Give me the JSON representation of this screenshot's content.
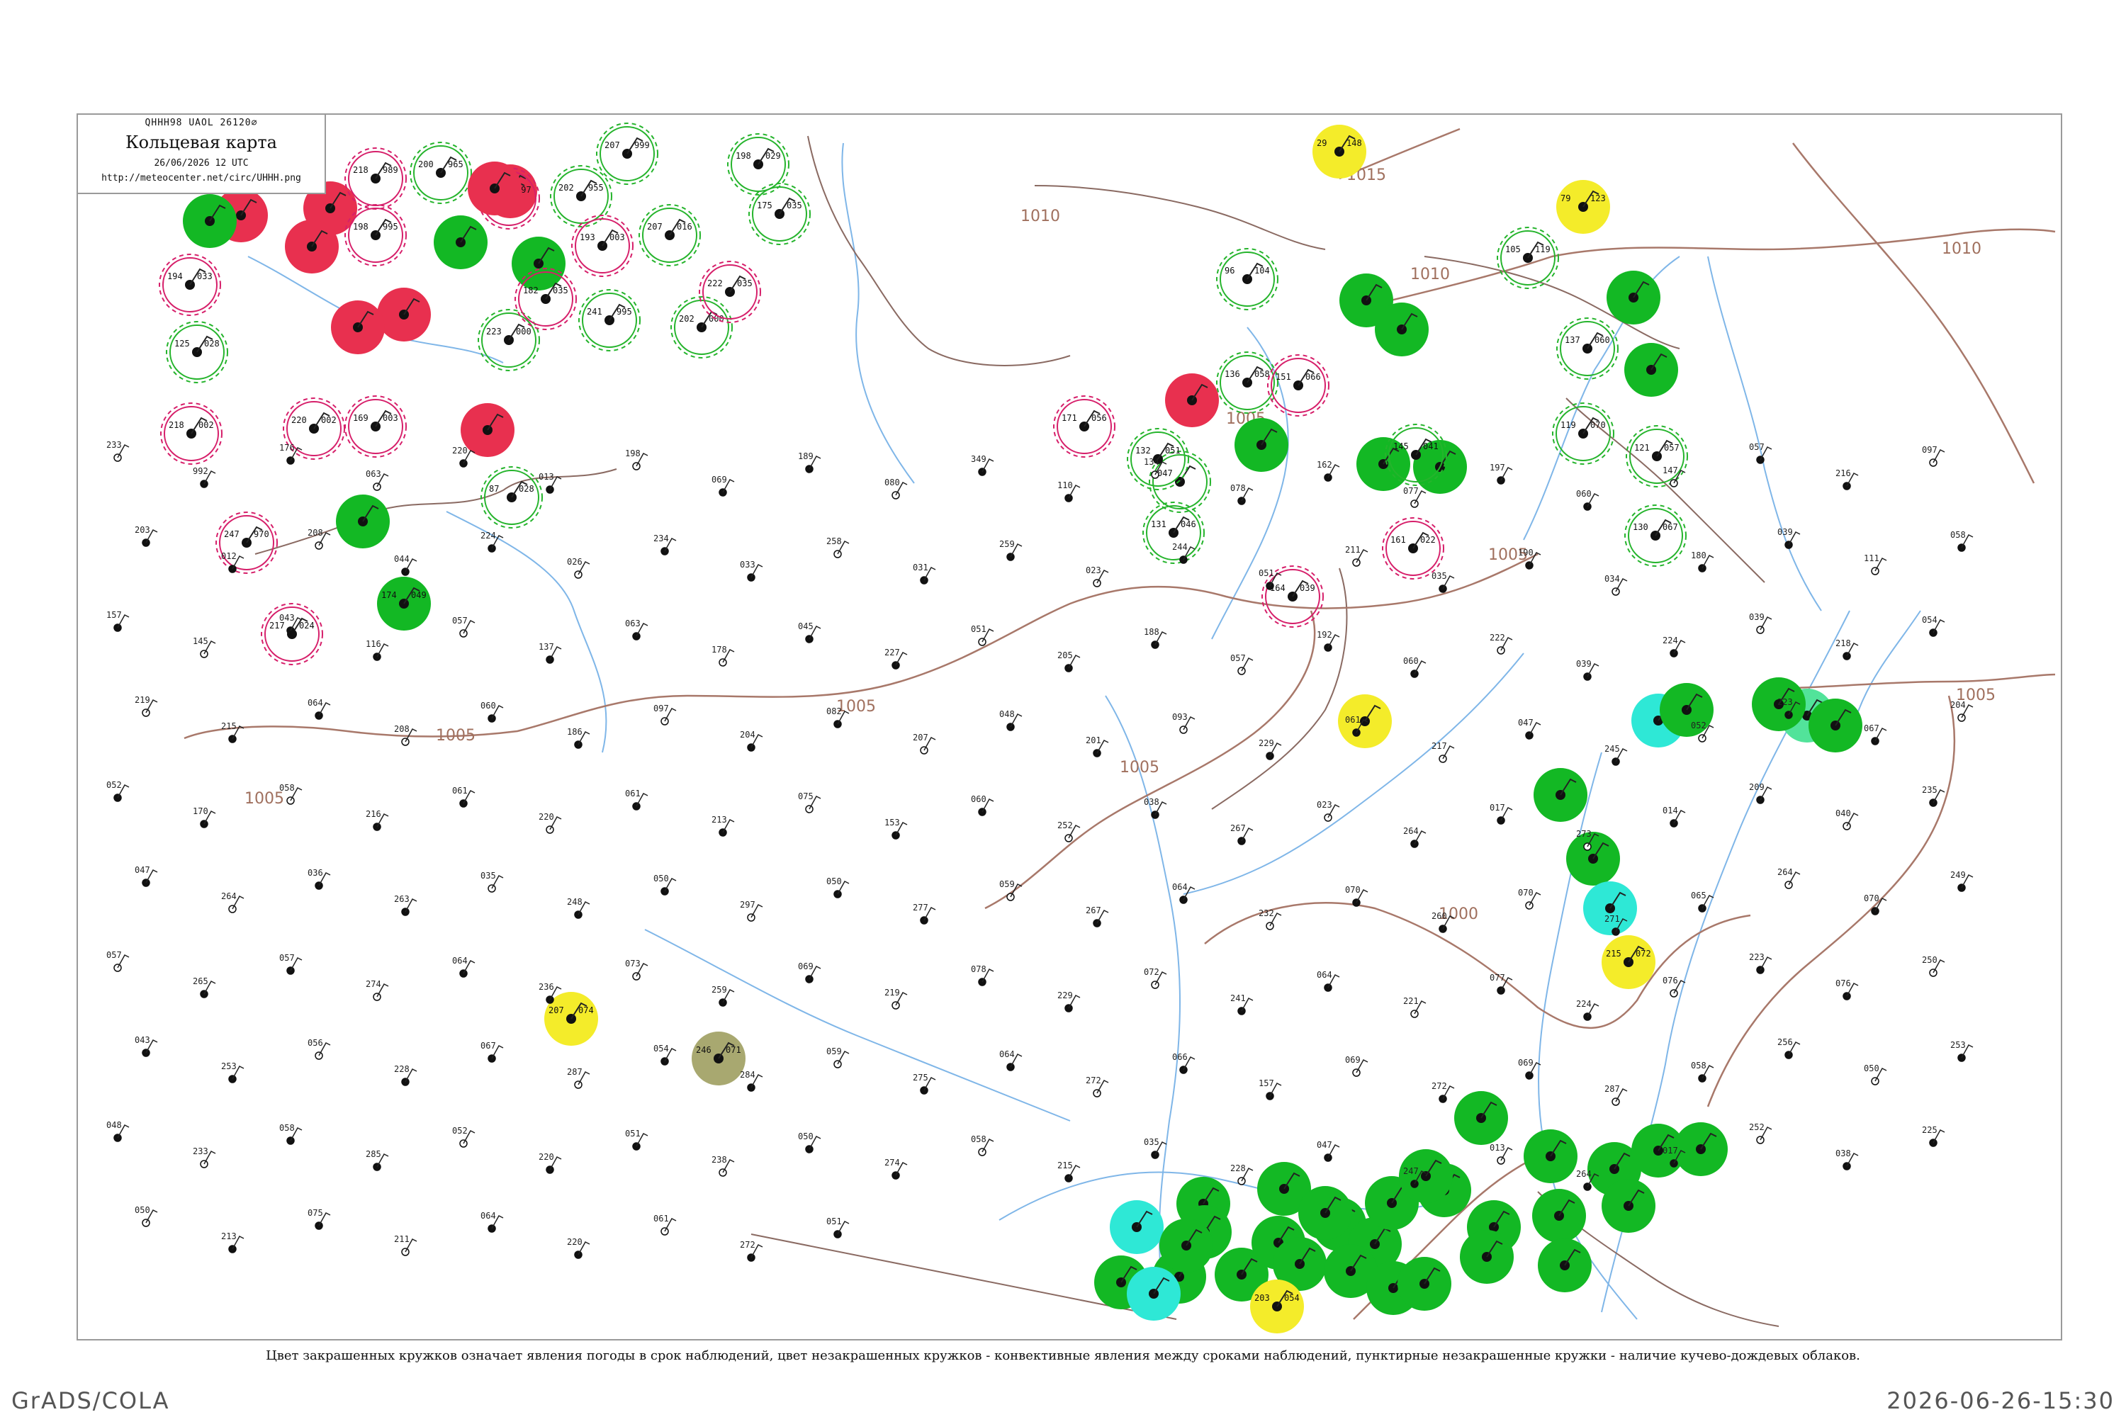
{
  "header": {
    "code": "QHHH98  UAOL  26120∅",
    "title": "Кольцевая карта",
    "date": "26/06/2026 12 UTC",
    "url": "http://meteocenter.net/circ/UHHH.png"
  },
  "isobar_labels": [
    "1015",
    "1010",
    "1010",
    "1010",
    "1005",
    "1005",
    "1005",
    "1005",
    "1005",
    "1005",
    "1000",
    "1005"
  ],
  "stations": [
    {
      "circle": "red",
      "ring": "",
      "t": "",
      "p": ""
    },
    {
      "circle": "red",
      "ring": "",
      "t": "",
      "p": ""
    },
    {
      "circle": "green",
      "ring": "",
      "t": "",
      "p": ""
    },
    {
      "circle": "red",
      "ring": "",
      "t": "",
      "p": ""
    },
    {
      "circle": "red",
      "ring": "",
      "t": "",
      "p": ""
    },
    {
      "circle": "",
      "ring": "red",
      "t": "168",
      "p": "997"
    },
    {
      "circle": "",
      "ring": "red",
      "t": "218",
      "p": "989"
    },
    {
      "circle": "",
      "ring": "green",
      "t": "200",
      "p": "965"
    },
    {
      "circle": "red",
      "ring": "",
      "t": "",
      "p": ""
    },
    {
      "circle": "green",
      "ring": "",
      "t": "",
      "p": ""
    },
    {
      "circle": "green",
      "ring": "",
      "t": "",
      "p": ""
    },
    {
      "circle": "",
      "ring": "red",
      "t": "198",
      "p": "995"
    },
    {
      "circle": "red",
      "ring": "",
      "t": "",
      "p": ""
    },
    {
      "circle": "red",
      "ring": "",
      "t": "",
      "p": ""
    },
    {
      "circle": "",
      "ring": "green",
      "t": "202",
      "p": "955"
    },
    {
      "circle": "",
      "ring": "green",
      "t": "207",
      "p": "999"
    },
    {
      "circle": "",
      "ring": "red",
      "t": "193",
      "p": "003"
    },
    {
      "circle": "",
      "ring": "green",
      "t": "207",
      "p": "016"
    },
    {
      "circle": "",
      "ring": "green",
      "t": "198",
      "p": "029"
    },
    {
      "circle": "",
      "ring": "green",
      "t": "175",
      "p": "035"
    },
    {
      "circle": "",
      "ring": "red",
      "t": "194",
      "p": "033"
    },
    {
      "circle": "",
      "ring": "green",
      "t": "125",
      "p": "028"
    },
    {
      "circle": "",
      "ring": "green",
      "t": "241",
      "p": "995"
    },
    {
      "circle": "",
      "ring": "green",
      "t": "223",
      "p": "000"
    },
    {
      "circle": "",
      "ring": "red",
      "t": "182",
      "p": "035"
    },
    {
      "circle": "",
      "ring": "green",
      "t": "202",
      "p": "000"
    },
    {
      "circle": "",
      "ring": "red",
      "t": "222",
      "p": "035"
    },
    {
      "circle": "",
      "ring": "red",
      "t": "220",
      "p": "002"
    },
    {
      "circle": "",
      "ring": "red",
      "t": "169",
      "p": "003"
    },
    {
      "circle": "",
      "ring": "red",
      "t": "218",
      "p": "002"
    },
    {
      "circle": "red",
      "ring": "",
      "t": "",
      "p": ""
    },
    {
      "circle": "",
      "ring": "green",
      "t": "87",
      "p": "028"
    },
    {
      "circle": "green",
      "ring": "",
      "t": "",
      "p": ""
    },
    {
      "circle": "",
      "ring": "red",
      "t": "247",
      "p": "970"
    },
    {
      "circle": "",
      "ring": "red",
      "t": "217",
      "p": "024"
    },
    {
      "circle": "green",
      "ring": "",
      "t": "174",
      "p": "049"
    },
    {
      "circle": "yellow",
      "ring": "",
      "t": "29",
      "p": "148"
    },
    {
      "circle": "yellow",
      "ring": "",
      "t": "79",
      "p": "123"
    },
    {
      "circle": "green",
      "ring": "",
      "t": "",
      "p": ""
    },
    {
      "circle": "green",
      "ring": "",
      "t": "",
      "p": ""
    },
    {
      "circle": "green",
      "ring": "",
      "t": "",
      "p": ""
    },
    {
      "circle": "green",
      "ring": "",
      "t": "",
      "p": ""
    },
    {
      "circle": "green",
      "ring": "",
      "t": "",
      "p": ""
    },
    {
      "circle": "red",
      "ring": "",
      "t": "",
      "p": ""
    },
    {
      "circle": "green",
      "ring": "",
      "t": "",
      "p": ""
    },
    {
      "circle": "green",
      "ring": "",
      "t": "",
      "p": ""
    },
    {
      "circle": "yellow",
      "ring": "",
      "t": "",
      "p": ""
    },
    {
      "circle": "cyan",
      "ring": "",
      "t": "",
      "p": ""
    },
    {
      "circle": "green",
      "ring": "",
      "t": "",
      "p": ""
    },
    {
      "circle": "mint",
      "ring": "",
      "t": "",
      "p": ""
    },
    {
      "circle": "green",
      "ring": "",
      "t": "",
      "p": ""
    },
    {
      "circle": "green",
      "ring": "",
      "t": "",
      "p": ""
    },
    {
      "circle": "green",
      "ring": "",
      "t": "",
      "p": ""
    },
    {
      "circle": "green",
      "ring": "",
      "t": "",
      "p": ""
    },
    {
      "circle": "cyan",
      "ring": "",
      "t": "",
      "p": ""
    },
    {
      "circle": "yellow",
      "ring": "",
      "t": "215",
      "p": "072"
    },
    {
      "circle": "yellow",
      "ring": "",
      "t": "207",
      "p": "074"
    },
    {
      "circle": "olive",
      "ring": "",
      "t": "246",
      "p": "071"
    },
    {
      "circle": "green",
      "ring": "",
      "t": "",
      "p": ""
    },
    {
      "circle": "green",
      "ring": "",
      "t": "",
      "p": ""
    },
    {
      "circle": "green",
      "ring": "",
      "t": "",
      "p": ""
    },
    {
      "circle": "green",
      "ring": "",
      "t": "",
      "p": ""
    },
    {
      "circle": "green",
      "ring": "",
      "t": "",
      "p": ""
    },
    {
      "circle": "green",
      "ring": "",
      "t": "",
      "p": ""
    },
    {
      "circle": "green",
      "ring": "",
      "t": "",
      "p": ""
    },
    {
      "circle": "green",
      "ring": "",
      "t": "",
      "p": ""
    },
    {
      "circle": "cyan",
      "ring": "",
      "t": "",
      "p": ""
    },
    {
      "circle": "green",
      "ring": "",
      "t": "",
      "p": ""
    },
    {
      "circle": "green",
      "ring": "",
      "t": "",
      "p": ""
    },
    {
      "circle": "green",
      "ring": "",
      "t": "",
      "p": ""
    },
    {
      "circle": "green",
      "ring": "",
      "t": "",
      "p": ""
    },
    {
      "circle": "green",
      "ring": "",
      "t": "",
      "p": ""
    },
    {
      "circle": "green",
      "ring": "",
      "t": "",
      "p": ""
    },
    {
      "circle": "cyan",
      "ring": "",
      "t": "",
      "p": ""
    },
    {
      "circle": "green",
      "ring": "",
      "t": "",
      "p": ""
    },
    {
      "circle": "green",
      "ring": "",
      "t": "",
      "p": ""
    },
    {
      "circle": "yellow",
      "ring": "",
      "t": "203",
      "p": "054"
    },
    {
      "circle": "green",
      "ring": "",
      "t": "",
      "p": ""
    },
    {
      "circle": "green",
      "ring": "",
      "t": "",
      "p": ""
    },
    {
      "circle": "green",
      "ring": "",
      "t": "",
      "p": ""
    },
    {
      "circle": "green",
      "ring": "",
      "t": "",
      "p": ""
    },
    {
      "circle": "green",
      "ring": "",
      "t": "",
      "p": ""
    },
    {
      "circle": "green",
      "ring": "",
      "t": "",
      "p": ""
    },
    {
      "circle": "green",
      "ring": "",
      "t": "",
      "p": ""
    },
    {
      "circle": "green",
      "ring": "",
      "t": "",
      "p": ""
    },
    {
      "circle": "green",
      "ring": "",
      "t": "",
      "p": ""
    },
    {
      "circle": "green",
      "ring": "",
      "t": "",
      "p": ""
    },
    {
      "circle": "green",
      "ring": "",
      "t": "",
      "p": ""
    },
    {
      "circle": "green",
      "ring": "",
      "t": "",
      "p": ""
    },
    {
      "circle": "",
      "ring": "green",
      "t": "96",
      "p": "104"
    },
    {
      "circle": "",
      "ring": "green",
      "t": "136",
      "p": "058"
    },
    {
      "circle": "",
      "ring": "green",
      "t": "047",
      "p": ""
    },
    {
      "circle": "",
      "ring": "green",
      "t": "132",
      "p": "051"
    },
    {
      "circle": "",
      "ring": "green",
      "t": "131",
      "p": "046"
    },
    {
      "circle": "",
      "ring": "green",
      "t": "145",
      "p": "041"
    },
    {
      "circle": "",
      "ring": "red",
      "t": "161",
      "p": "022"
    },
    {
      "circle": "",
      "ring": "red",
      "t": "164",
      "p": "039"
    },
    {
      "circle": "",
      "ring": "green",
      "t": "105",
      "p": "119"
    },
    {
      "circle": "",
      "ring": "green",
      "t": "137",
      "p": "060"
    },
    {
      "circle": "",
      "ring": "green",
      "t": "119",
      "p": "070"
    },
    {
      "circle": "",
      "ring": "green",
      "t": "121",
      "p": "057"
    },
    {
      "circle": "",
      "ring": "green",
      "t": "130",
      "p": "067"
    },
    {
      "circle": "",
      "ring": "red",
      "t": "151",
      "p": "066"
    },
    {
      "circle": "",
      "ring": "red",
      "t": "171",
      "p": "056"
    }
  ],
  "plain_values": [
    "233",
    "992",
    "176",
    "063",
    "220",
    "013",
    "198",
    "069",
    "189",
    "080",
    "349",
    "110",
    "134",
    "078",
    "162",
    "077",
    "197",
    "060",
    "147",
    "057",
    "216",
    "097",
    "203",
    "012",
    "208",
    "044",
    "224",
    "026",
    "234",
    "033",
    "258",
    "031",
    "259",
    "023",
    "244",
    "051",
    "211",
    "035",
    "190",
    "034",
    "180",
    "039",
    "111",
    "058",
    "157",
    "145",
    "043",
    "116",
    "057",
    "137",
    "063",
    "178",
    "045",
    "227",
    "051",
    "205",
    "188",
    "057",
    "192",
    "060",
    "222",
    "039",
    "224",
    "039",
    "218",
    "054",
    "219",
    "215",
    "064",
    "208",
    "060",
    "186",
    "097",
    "204",
    "082",
    "207",
    "048",
    "201",
    "093",
    "229",
    "061",
    "217",
    "047",
    "245",
    "052",
    "223",
    "067",
    "204",
    "052",
    "170",
    "058",
    "216",
    "061",
    "220",
    "061",
    "213",
    "075",
    "153",
    "060",
    "252",
    "038",
    "267",
    "023",
    "264",
    "017",
    "273",
    "014",
    "209",
    "040",
    "235",
    "047",
    "264",
    "036",
    "263",
    "035",
    "248",
    "050",
    "297",
    "050",
    "277",
    "059",
    "267",
    "064",
    "232",
    "070",
    "260",
    "070",
    "271",
    "065",
    "264",
    "070",
    "249",
    "057",
    "265",
    "057",
    "274",
    "064",
    "236",
    "073",
    "259",
    "069",
    "219",
    "078",
    "229",
    "072",
    "241",
    "064",
    "221",
    "077",
    "224",
    "076",
    "223",
    "076",
    "250",
    "043",
    "253",
    "056",
    "228",
    "067",
    "287",
    "054",
    "284",
    "059",
    "275",
    "064",
    "272",
    "066",
    "157",
    "069",
    "272",
    "069",
    "287",
    "058",
    "256",
    "050",
    "253",
    "048",
    "233",
    "058",
    "285",
    "052",
    "220",
    "051",
    "238",
    "050",
    "274",
    "058",
    "215",
    "035",
    "228",
    "047",
    "247",
    "013",
    "264",
    "017",
    "252",
    "038",
    "225",
    "050",
    "213",
    "075",
    "211",
    "064",
    "220",
    "061",
    "272",
    "051"
  ],
  "footer": {
    "note": "Цвет закрашенных кружков означает явления погоды в срок наблюдений, цвет незакрашенных кружков - конвективные явления между сроками наблюдений, пунктирные незакрашенные кружки - наличие кучево-дождевых облаков.",
    "left": "GrADS/COLA",
    "right": "2026-06-26-15:30"
  },
  "colors": {
    "red_fill": "#e8304f",
    "green_fill": "#13b824",
    "yellow_fill": "#f4ec2a",
    "cyan_fill": "#2ee8d6",
    "mint_fill": "#52e39a",
    "olive_fill": "#a8a870",
    "isobar": "#a8786a",
    "river": "#7fb6e8",
    "ring_red": "#d61f6a",
    "ring_green": "#25b42c"
  }
}
